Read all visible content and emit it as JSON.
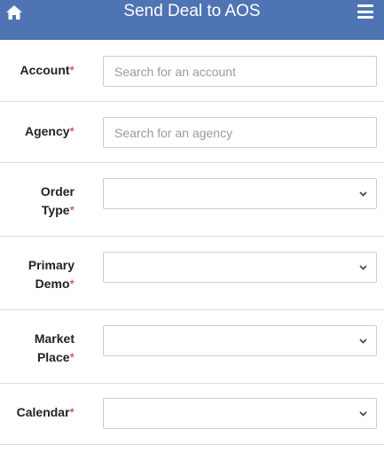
{
  "header": {
    "title": "Send Deal to AOS",
    "home_icon": "home-icon",
    "menu_icon": "hamburger-menu-icon",
    "background": "#4f74b3"
  },
  "form": {
    "required_marker": "*",
    "account": {
      "label": "Account",
      "placeholder": "Search for an account"
    },
    "agency": {
      "label": "Agency",
      "placeholder": "Search for an agency"
    },
    "order_type": {
      "label_line1": "Order",
      "label_line2": "Type",
      "value": ""
    },
    "primary_demo": {
      "label_line1": "Primary",
      "label_line2": "Demo",
      "value": ""
    },
    "market_place": {
      "label_line1": "Market",
      "label_line2": "Place",
      "value": ""
    },
    "calendar": {
      "label": "Calendar",
      "value": ""
    }
  }
}
